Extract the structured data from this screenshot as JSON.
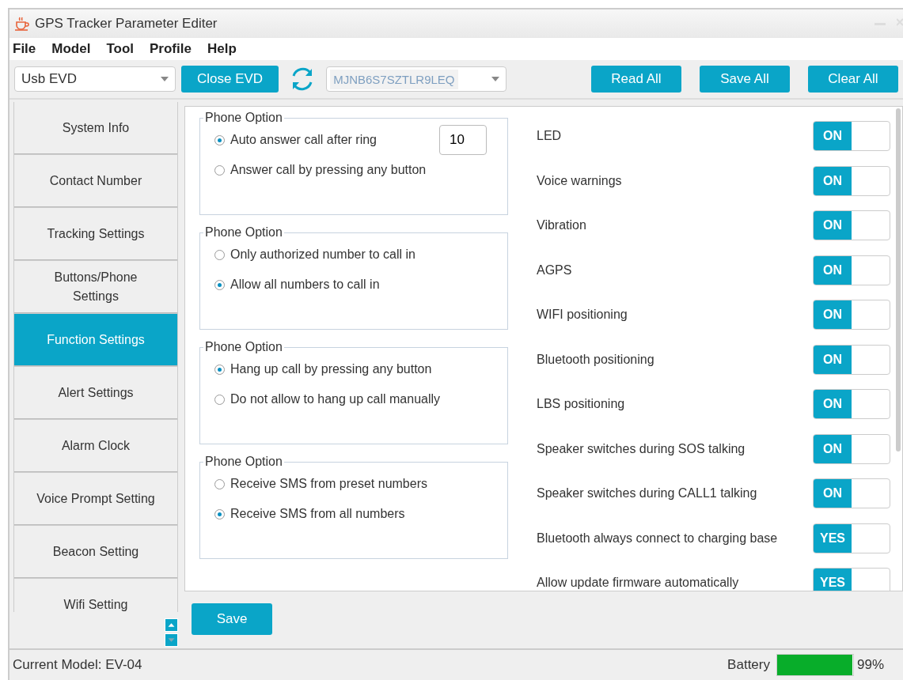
{
  "window": {
    "title": "GPS Tracker Parameter Editer"
  },
  "menu": [
    "File",
    "Model",
    "Tool",
    "Profile",
    "Help"
  ],
  "toolbar": {
    "port": "Usb EVD",
    "connect_button": "Close EVD",
    "device_id": "MJNB6S7SZTLR9LEQ",
    "buttons": [
      "Read All",
      "Save All",
      "Clear All"
    ]
  },
  "sidebar": {
    "items": [
      {
        "label": "System Info",
        "selected": false
      },
      {
        "label": "Contact Number",
        "selected": false
      },
      {
        "label": "Tracking Settings",
        "selected": false
      },
      {
        "label": "Buttons/Phone Settings",
        "selected": false
      },
      {
        "label": "Function Settings",
        "selected": true
      },
      {
        "label": "Alert Settings",
        "selected": false
      },
      {
        "label": "Alarm Clock",
        "selected": false
      },
      {
        "label": "Voice Prompt Setting",
        "selected": false
      },
      {
        "label": "Beacon Setting",
        "selected": false
      },
      {
        "label": "Wifi Setting",
        "selected": false
      }
    ]
  },
  "groups": [
    {
      "title": "Phone Option",
      "options": [
        {
          "label": "Auto answer call after ring",
          "selected": true,
          "value": "10"
        },
        {
          "label": "Answer call by pressing any button",
          "selected": false
        }
      ]
    },
    {
      "title": "Phone Option",
      "options": [
        {
          "label": "Only authorized number to call in",
          "selected": false
        },
        {
          "label": "Allow all numbers to call in",
          "selected": true
        }
      ]
    },
    {
      "title": "Phone Option",
      "options": [
        {
          "label": "Hang up call by pressing any button",
          "selected": true
        },
        {
          "label": "Do not allow to hang up call manually",
          "selected": false
        }
      ]
    },
    {
      "title": "Phone Option",
      "options": [
        {
          "label": "Receive SMS from preset numbers",
          "selected": false
        },
        {
          "label": "Receive SMS from all numbers",
          "selected": true
        }
      ]
    }
  ],
  "switches": [
    {
      "label": "LED",
      "state": "ON",
      "on": true
    },
    {
      "label": "Voice warnings",
      "state": "ON",
      "on": true
    },
    {
      "label": "Vibration",
      "state": "ON",
      "on": true
    },
    {
      "label": "AGPS",
      "state": "ON",
      "on": true
    },
    {
      "label": "WIFI positioning",
      "state": "ON",
      "on": true
    },
    {
      "label": "Bluetooth positioning",
      "state": "ON",
      "on": true
    },
    {
      "label": "LBS positioning",
      "state": "ON",
      "on": true
    },
    {
      "label": "Speaker switches during SOS talking",
      "state": "ON",
      "on": true
    },
    {
      "label": "Speaker switches during CALL1 talking",
      "state": "ON",
      "on": true
    },
    {
      "label": "Bluetooth always connect to charging base",
      "state": "YES",
      "on": true
    },
    {
      "label": "Allow update firmware automatically",
      "state": "YES",
      "on": true
    }
  ],
  "save_button": "Save",
  "status_bar": {
    "model": "Current Model: EV-04",
    "battery_label": "Battery",
    "battery": {
      "level": 0.99
    },
    "battery_text": "99%"
  }
}
